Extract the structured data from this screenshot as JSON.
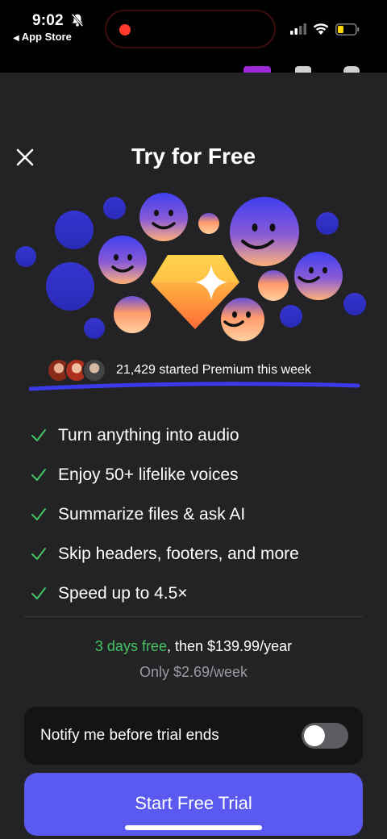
{
  "status_bar": {
    "time": "9:02",
    "back_label": "App Store"
  },
  "header": {
    "title": "Try for Free"
  },
  "social_proof": {
    "text": "21,429 started Premium this week"
  },
  "features": [
    "Turn anything into audio",
    "Enjoy 50+ lifelike voices",
    "Summarize files & ask AI",
    "Skip headers, footers, and more",
    "Speed up to 4.5×"
  ],
  "pricing": {
    "trial": "3 days free",
    "then": ", then $139.99/year",
    "weekly": "Only $2.69/week"
  },
  "notify": {
    "label": "Notify me before trial ends",
    "enabled": false
  },
  "cta": {
    "label": "Start Free Trial"
  },
  "colors": {
    "accent": "#5a5af0",
    "check": "#44c463",
    "sheet_bg": "#232325"
  }
}
